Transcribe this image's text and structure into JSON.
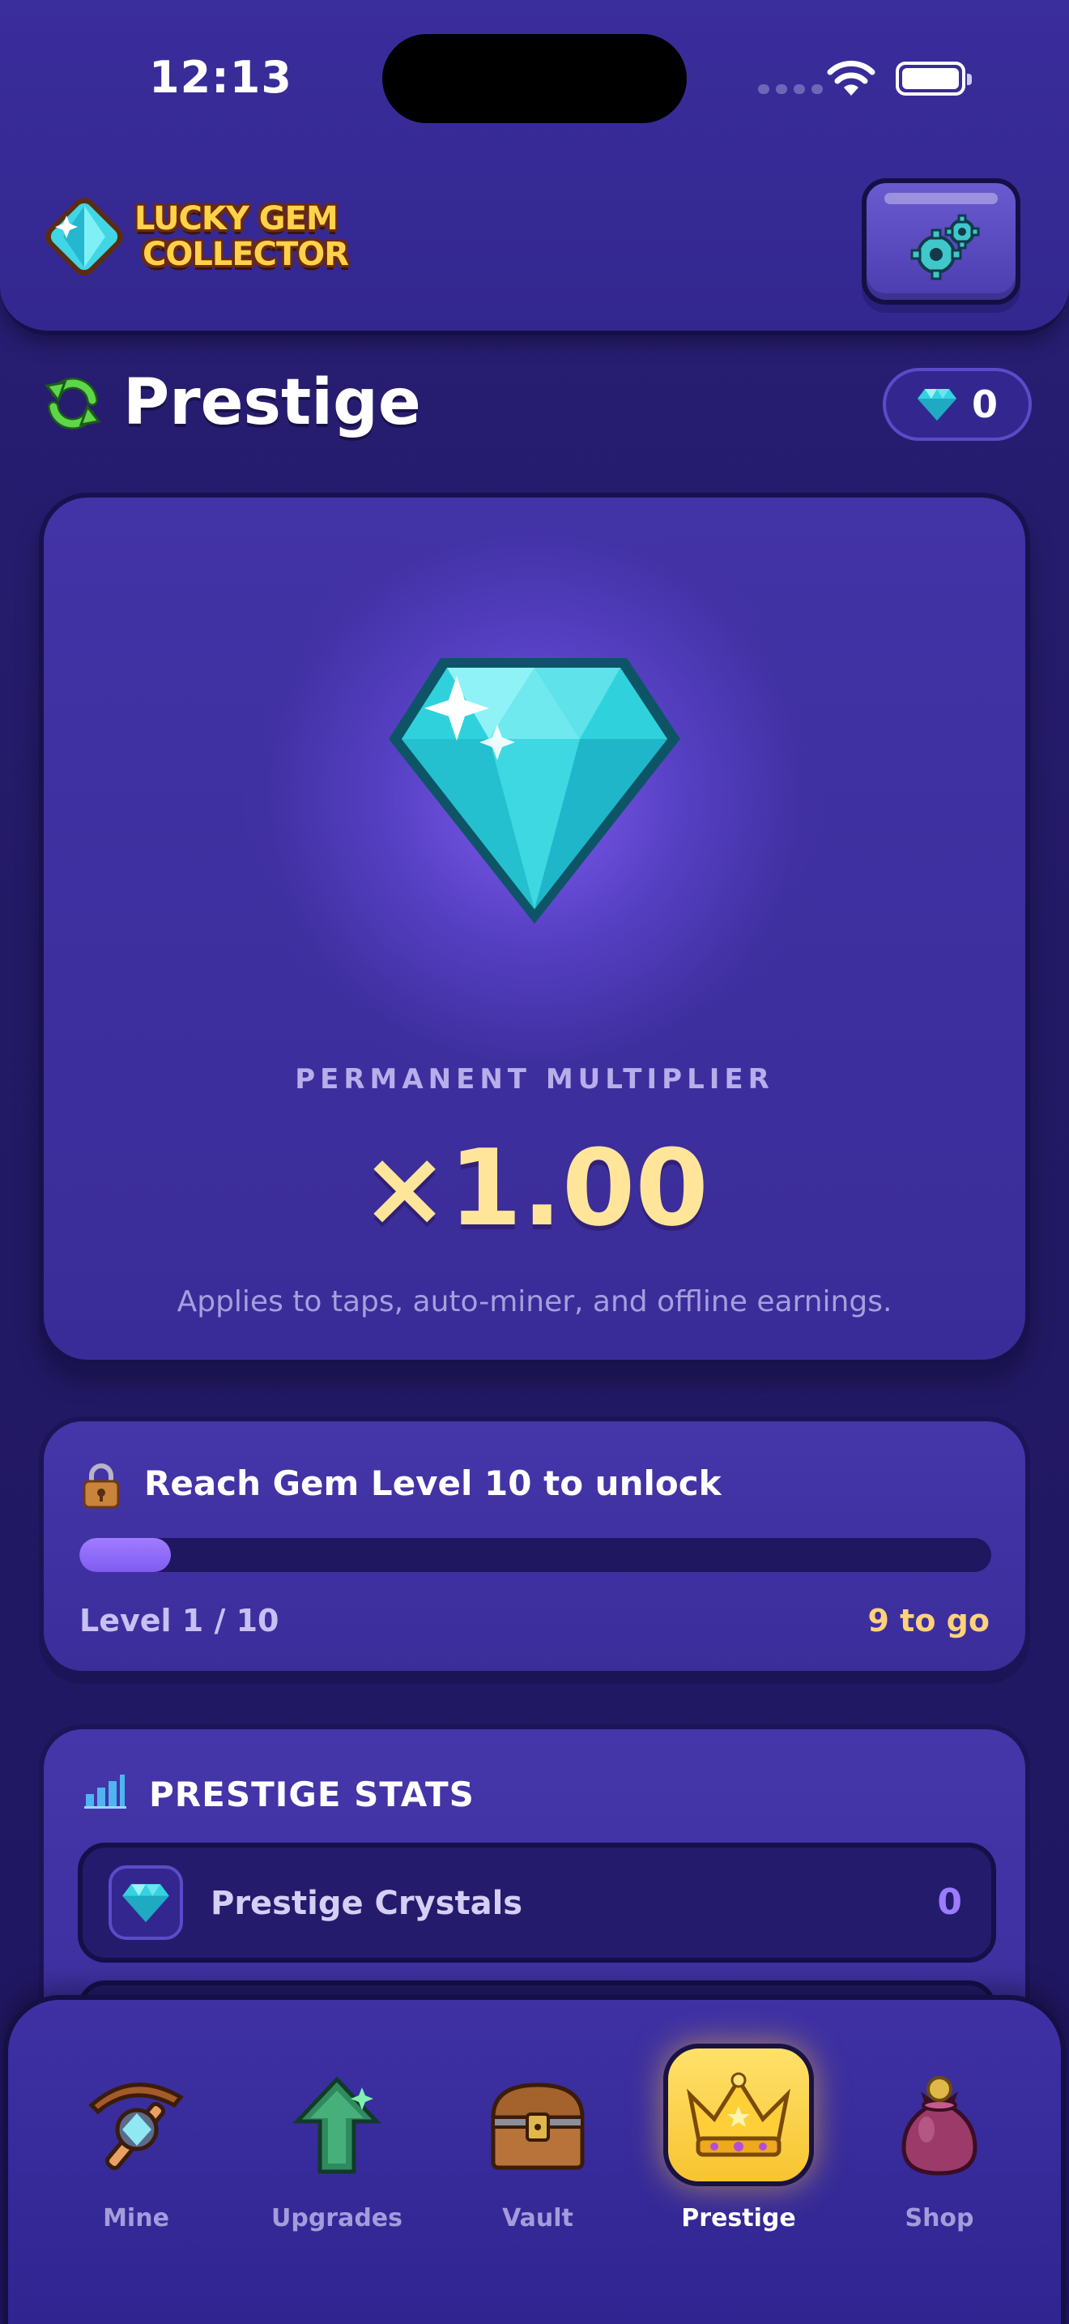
{
  "status_bar": {
    "time": "12:13"
  },
  "header": {
    "logo_line1": "LUCKY GEM",
    "logo_line2": "COLLECTOR"
  },
  "page": {
    "title": "Prestige",
    "crystal_count": "0"
  },
  "multiplier": {
    "label": "PERMANENT MULTIPLIER",
    "value": "×1.00",
    "note": "Applies to taps, auto-miner, and offline earnings."
  },
  "unlock": {
    "title": "Reach Gem Level 10 to unlock",
    "progress_fraction": 0.1,
    "level_text": "Level 1 / 10",
    "remaining_text": "9 to go"
  },
  "stats": {
    "title": "PRESTIGE STATS",
    "rows": [
      {
        "label": "Prestige Crystals",
        "value": "0"
      }
    ]
  },
  "nav": {
    "items": [
      {
        "label": "Mine",
        "icon": "pickaxe-icon"
      },
      {
        "label": "Upgrades",
        "icon": "upgrade-arrow-icon"
      },
      {
        "label": "Vault",
        "icon": "treasure-chest-icon"
      },
      {
        "label": "Prestige",
        "icon": "crown-icon",
        "active": true
      },
      {
        "label": "Shop",
        "icon": "coin-bag-icon"
      }
    ]
  },
  "colors": {
    "background": "#231a66",
    "accent_gold": "#ffe59a",
    "progress": "#7f5cf2",
    "active_tab": "#f7c431"
  }
}
